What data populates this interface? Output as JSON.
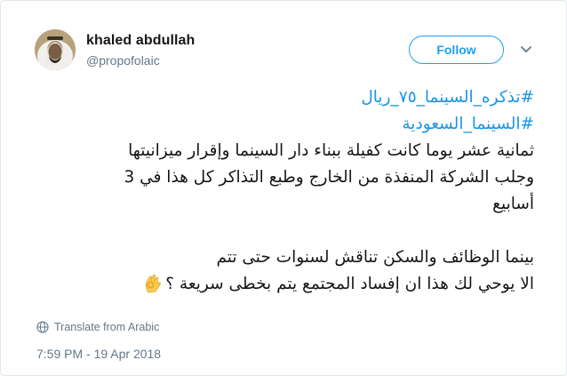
{
  "author": {
    "display_name": "khaled abdullah",
    "handle": "@propofolaic"
  },
  "follow_button": {
    "label": "Follow"
  },
  "tweet": {
    "hashtags": [
      "#تذكره_السينما_٧٥_ريال",
      "#السينما_السعودية"
    ],
    "lines": [
      "ثمانية عشر يوما كانت كفيلة ببناء دار السينما وإقرار ميزانيتها",
      "وجلب الشركة المنفذة من الخارج وطبع التذاكر كل هذا في 3",
      "أسابيع",
      "بينما الوظائف والسكن تناقش لسنوات حتى تتم",
      "الا يوحي لك هذا ان إفساد المجتمع يتم بخطى سريعة ؟"
    ],
    "emoji": "ok-hand-emoji"
  },
  "translate": {
    "label": "Translate from Arabic",
    "icon": "globe-icon"
  },
  "timestamp": "7:59 PM - 19 Apr 2018",
  "colors": {
    "accent": "#1da1f2",
    "hashtag": "#1b95e0",
    "secondary_text": "#657786",
    "border": "#e1e8ed"
  }
}
